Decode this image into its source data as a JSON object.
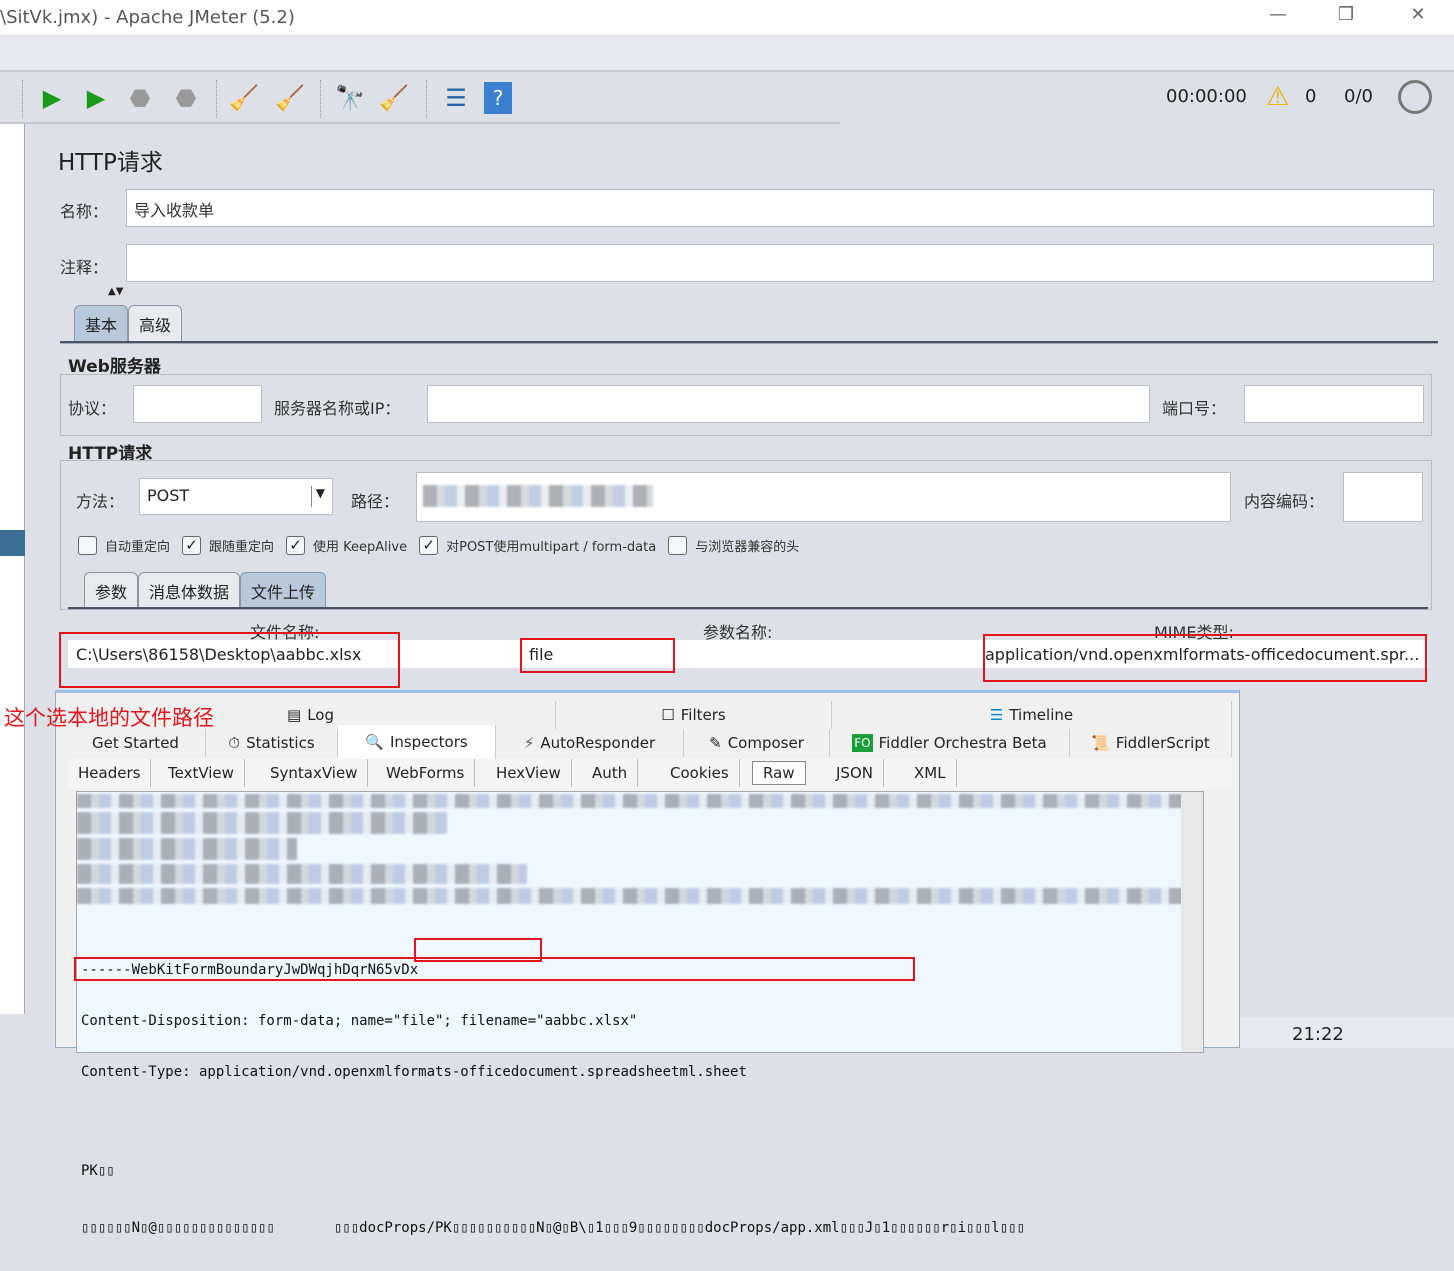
{
  "window": {
    "title": "\\SitVk.jmx) - Apache JMeter (5.2)",
    "minimize": "—",
    "restore": "❐",
    "close": "✕"
  },
  "toolbar": {
    "timer": "00:00:00",
    "warnings": "0",
    "threads": "0/0"
  },
  "sampler": {
    "title": "HTTP请求",
    "name_label": "名称：",
    "name_value": "导入收款单",
    "comment_label": "注释：",
    "comment_value": ""
  },
  "tabs_main": [
    {
      "label": "基本"
    },
    {
      "label": "高级"
    }
  ],
  "web_server": {
    "header": "Web服务器",
    "protocol_label": "协议：",
    "server_label": "服务器名称或IP：",
    "port_label": "端口号："
  },
  "http_request": {
    "header": "HTTP请求",
    "method_label": "方法：",
    "method_value": "POST",
    "path_label": "路径：",
    "encoding_label": "内容编码："
  },
  "checkboxes": [
    {
      "label": "自动重定向",
      "checked": false
    },
    {
      "label": "跟随重定向",
      "checked": true
    },
    {
      "label": "使用 KeepAlive",
      "checked": true
    },
    {
      "label": "对POST使用multipart / form-data",
      "checked": true
    },
    {
      "label": "与浏览器兼容的头",
      "checked": false
    }
  ],
  "tabs_params": [
    {
      "label": "参数"
    },
    {
      "label": "消息体数据"
    },
    {
      "label": "文件上传",
      "selected": true
    }
  ],
  "files_table": {
    "headers": [
      "文件名称:",
      "参数名称:",
      "MIME类型:"
    ],
    "row": [
      "C:\\Users\\86158\\Desktop\\aabbc.xlsx",
      "file",
      "application/vnd.openxmlformats-officedocument.spr..."
    ]
  },
  "annotation": "这个选本地的文件路径",
  "fiddler": {
    "top_tabs": [
      {
        "label": "Log",
        "icon": "log-icon"
      },
      {
        "label": "Filters",
        "icon": "checkbox-icon"
      },
      {
        "label": "Timeline",
        "icon": "timeline-icon"
      }
    ],
    "main_tabs": [
      {
        "label": "Get Started"
      },
      {
        "label": "Statistics",
        "icon": "stopwatch-icon"
      },
      {
        "label": "Inspectors",
        "icon": "magnifier-icon",
        "selected": true
      },
      {
        "label": "AutoResponder",
        "icon": "lightning-icon"
      },
      {
        "label": "Composer",
        "icon": "composer-icon"
      },
      {
        "label": "Fiddler Orchestra Beta",
        "icon": "fo-icon"
      },
      {
        "label": "FiddlerScript",
        "icon": "script-icon"
      }
    ],
    "sub_tabs": [
      {
        "label": "Headers"
      },
      {
        "label": "TextView"
      },
      {
        "label": "SyntaxView"
      },
      {
        "label": "WebForms"
      },
      {
        "label": "HexView"
      },
      {
        "label": "Auth"
      },
      {
        "label": "Cookies"
      },
      {
        "label": "Raw",
        "selected": true
      },
      {
        "label": "JSON"
      },
      {
        "label": "XML"
      }
    ],
    "raw_lines": [
      "------WebKitFormBoundaryJwDWqjhDqrN65vDx",
      "Content-Disposition: form-data; name=\"file\"; filename=\"aabbc.xlsx\"",
      "Content-Type: application/vnd.openxmlformats-officedocument.spreadsheetml.sheet",
      "",
      "PK▯▯",
      "▯▯▯▯▯▯N▯@▯▯▯▯▯▯▯▯▯▯▯▯▯▯       ▯▯▯docProps/PK▯▯▯▯▯▯▯▯▯▯N▯@▯B\\▯1▯▯▯9▯▯▯▯▯▯▯▯docProps/app.xml▯▯▯J▯1▯▯▯▯▯▯r▯i▯▯▯l▯▯▯"
    ]
  },
  "taskbar": {
    "time": "21:22"
  }
}
